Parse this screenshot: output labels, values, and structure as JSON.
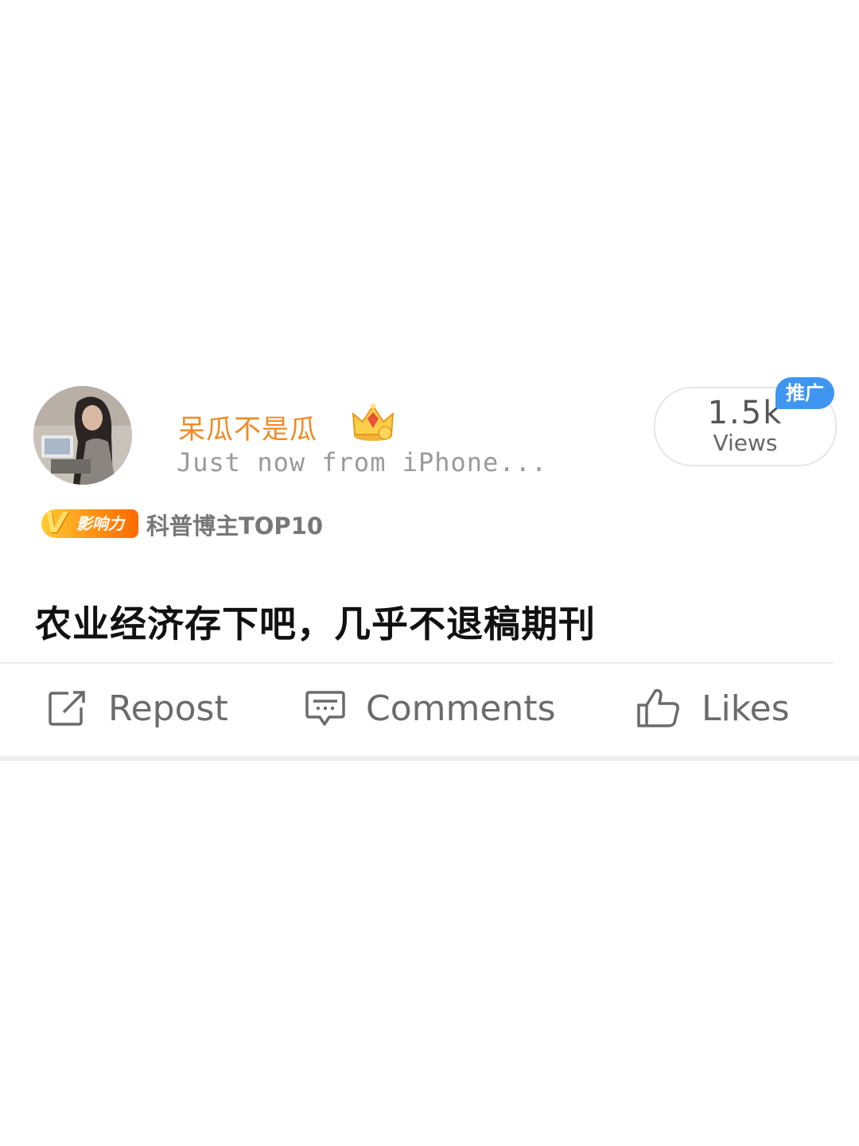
{
  "user": {
    "name": "呆瓜不是瓜",
    "meta": "Just now from iPhone...",
    "avatar_icon": "avatar-photo",
    "crown_icon": "crown-icon"
  },
  "views": {
    "count": "1.5k",
    "label": "Views",
    "promo_tag": "推广"
  },
  "badge": {
    "v_letter": "V",
    "label": "影响力",
    "description": "科普博主TOP10"
  },
  "post": {
    "text": "农业经济存下吧，几乎不退稿期刊"
  },
  "actions": {
    "repost": "Repost",
    "comments": "Comments",
    "likes": "Likes"
  },
  "colors": {
    "username": "#f08a24",
    "promo": "#3f96f0",
    "badge_start": "#ffcc33",
    "badge_end": "#ff6a00"
  }
}
